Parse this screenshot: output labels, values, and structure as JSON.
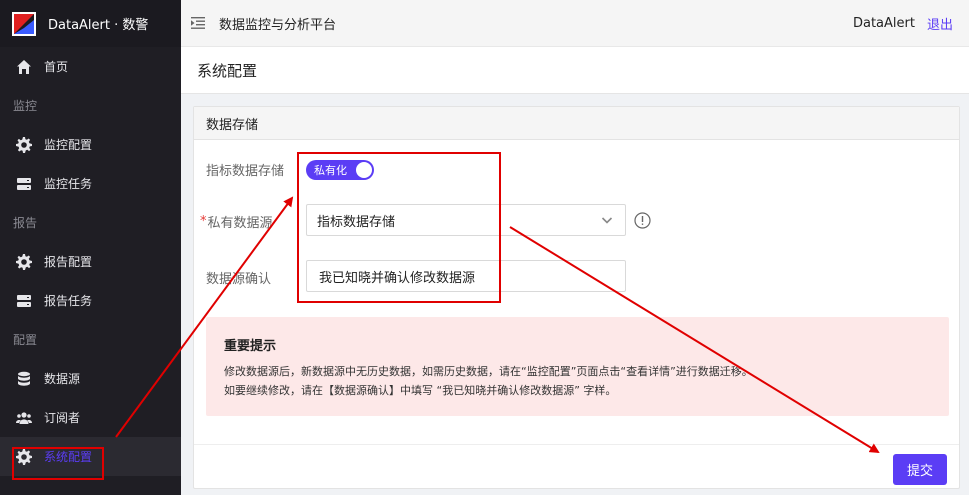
{
  "app": {
    "logo_text": "DataAlert · 数警"
  },
  "header": {
    "title": "数据监控与分析平台",
    "user": "DataAlert",
    "logout": "退出",
    "fold_icon": "menu-fold-icon"
  },
  "sidebar": {
    "home": "首页",
    "group_monitor": "监控",
    "monitor_config": "监控配置",
    "monitor_task": "监控任务",
    "group_report": "报告",
    "report_config": "报告配置",
    "report_task": "报告任务",
    "group_config": "配置",
    "datasource": "数据源",
    "subscriber": "订阅者",
    "system_config": "系统配置"
  },
  "page": {
    "title": "系统配置"
  },
  "card": {
    "title": "数据存储",
    "metric_storage_label": "指标数据存储",
    "metric_storage_switch": "私有化",
    "private_source_label": "私有数据源",
    "private_source_value": "指标数据存储",
    "confirm_label": "数据源确认",
    "confirm_value": "我已知晓并确认修改数据源",
    "alert_title": "重要提示",
    "alert_line1": "修改数据源后，新数据源中无历史数据，如需历史数据，请在“监控配置”页面点击“查看详情”进行数据迁移。",
    "alert_line2": "如要继续修改，请在【数据源确认】中填写 “我已知晓并确认修改数据源” 字样。",
    "submit": "提交"
  },
  "colors": {
    "accent": "#5b3df5",
    "sidebar_bg": "#1f1e24",
    "alert_bg": "#fde8e8",
    "annotation": "#e00000"
  }
}
